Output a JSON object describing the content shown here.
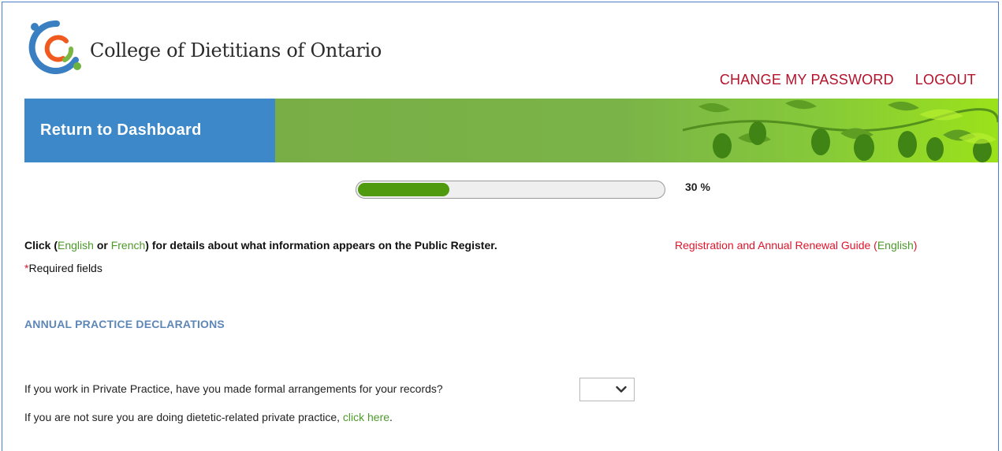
{
  "header": {
    "org_name": "College of Dietitians of Ontario",
    "logo_icon": "cdo-logo-icon",
    "links": {
      "change_password": "CHANGE MY PASSWORD",
      "logout": "LOGOUT"
    }
  },
  "banner": {
    "dashboard_label": "Return to Dashboard",
    "image": "pear-branch-leaves-image"
  },
  "progress": {
    "value_percent": 30,
    "label": "30 %",
    "fill_color": "#4f9a0e"
  },
  "info": {
    "prefix": "Click (",
    "english": "English",
    "or": " or ",
    "french": "French",
    "suffix": ") for details about what information appears on the Public Register.",
    "guide_text": "Registration and Annual Renewal Guide (",
    "guide_link": "English",
    "guide_close": ")",
    "required_star": "*",
    "required_text": "Required fields"
  },
  "section": {
    "title": "ANNUAL PRACTICE DECLARATIONS",
    "question": "If you work in Private Practice, have you made formal arrangements for your records?",
    "select_value": "",
    "note_text": "If you are not sure you are doing dietetic-related private practice, ",
    "note_link": "click here",
    "note_end": "."
  },
  "colors": {
    "accent_blue": "#3d88c9",
    "link_red": "#b3122a",
    "link_green": "#4c9a2a",
    "section_blue": "#5e87b8",
    "required_red": "#e0142a"
  }
}
